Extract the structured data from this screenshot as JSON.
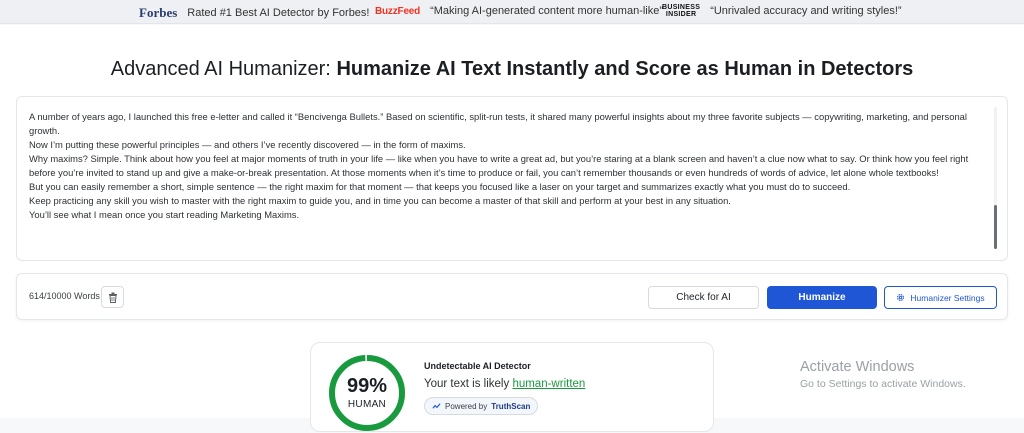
{
  "press_bar": {
    "items": [
      {
        "logo": "Forbes",
        "quote": "Rated #1 Best AI Detector by Forbes!"
      },
      {
        "logo": "BuzzFeed",
        "quote": "“Making AI-generated content more human-like”"
      },
      {
        "logo_line1": "BUSINESS",
        "logo_line2": "INSIDER",
        "quote": "“Unrivaled accuracy and writing styles!”"
      }
    ]
  },
  "headline": {
    "prefix": "Advanced AI Humanizer:",
    "strong": "Humanize AI Text Instantly and Score as Human in Detectors"
  },
  "editor": {
    "paragraphs": [
      "A number of years ago, I launched this free e-letter and called it “Bencivenga Bullets.” Based on scientific, split-run tests, it shared many powerful insights about my three favorite subjects — copywriting, marketing, and personal growth.",
      "Now I’m putting these powerful principles — and others I’ve recently discovered — in the form of maxims.",
      "Why maxims? Simple. Think about how you feel at major moments of truth in your life — like when you have to write a great ad, but you’re staring at a blank screen and haven’t a clue now what to say. Or think how you feel right before you’re invited to stand up and give a make-or-break presentation. At those moments when it’s time to produce or fail, you can’t remember thousands or even hundreds of words of advice, let alone whole textbooks!",
      "But you can easily remember a short, simple sentence — the right maxim for that moment — that keeps you focused like a laser on your target and summarizes exactly what you must do to succeed.",
      "Keep practicing any skill you wish to master with the right maxim to guide you, and in time you can become a master of that skill and perform at your best in any situation.",
      "You’ll see what I mean once you start reading Marketing Maxims."
    ]
  },
  "actions": {
    "word_count": "614/10000 Words",
    "check_label": "Check for AI",
    "humanize_label": "Humanize",
    "settings_label": "Humanizer Settings"
  },
  "result": {
    "score": "99%",
    "score_fraction": 0.99,
    "score_label": "HUMAN",
    "detector_title": "Undetectable AI Detector",
    "verdict_prefix": "Your text is likely",
    "verdict_value": "human-written",
    "powered_prefix": "Powered by",
    "powered_brand": "TruthScan"
  },
  "watermark": {
    "title": "Activate Windows",
    "subtitle": "Go to Settings to activate Windows."
  },
  "colors": {
    "accent": "#1f56d6",
    "human_green": "#1a9a3e"
  },
  "icons": {
    "trash": "trash-icon",
    "settings": "gear-icon",
    "powered": "truthscan-logo-icon"
  }
}
